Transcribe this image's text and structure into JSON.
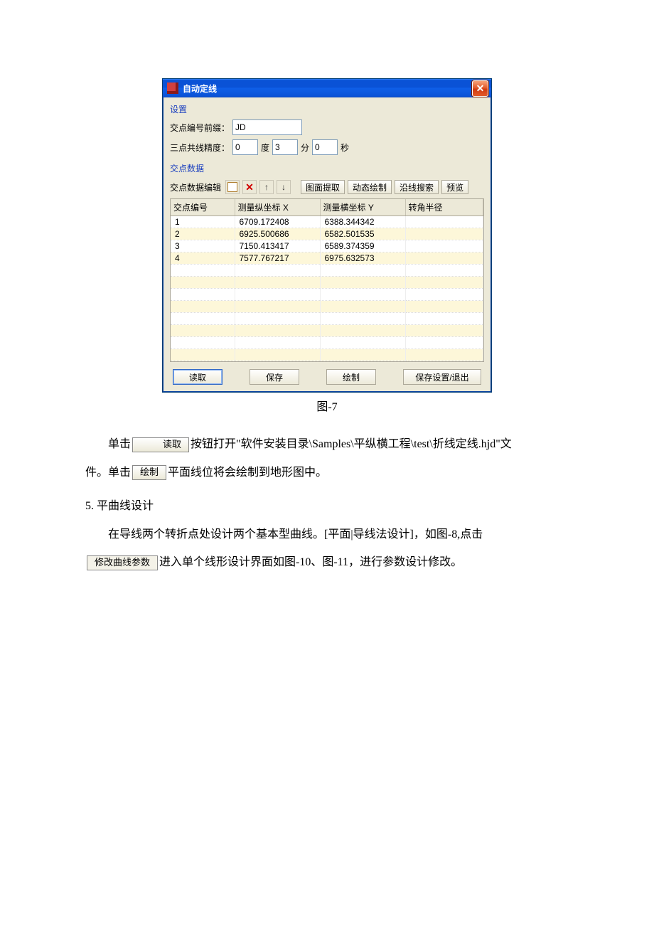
{
  "dialog": {
    "title": "自动定线",
    "group_settings": "设置",
    "prefix_label": "交点编号前缀：",
    "prefix_value": "JD",
    "precision_label": "三点共线精度：",
    "deg_value": "0",
    "deg_unit": "度",
    "min_value": "3",
    "min_unit": "分",
    "sec_value": "0",
    "sec_unit": "秒",
    "group_data": "交点数据",
    "edit_label": "交点数据编辑",
    "btn_extract": "图面提取",
    "btn_dynamic": "动态绘制",
    "btn_search": "沿线搜索",
    "btn_preview": "预览",
    "headers": [
      "交点编号",
      "测量纵坐标 X",
      "测量横坐标 Y",
      "转角半径"
    ],
    "rows": [
      {
        "id": "1",
        "x": "6709.172408",
        "y": "6388.344342",
        "r": ""
      },
      {
        "id": "2",
        "x": "6925.500686",
        "y": "6582.501535",
        "r": ""
      },
      {
        "id": "3",
        "x": "7150.413417",
        "y": "6589.374359",
        "r": ""
      },
      {
        "id": "4",
        "x": "7577.767217",
        "y": "6975.632573",
        "r": ""
      }
    ],
    "btn_read": "读取",
    "btn_save": "保存",
    "btn_draw": "绘制",
    "btn_save_exit": "保存设置/退出"
  },
  "caption": "图-7",
  "body": {
    "p1_prefix": "单击",
    "btn_read": "读取",
    "p1_suffix": "按钮打开\"软件安装目录\\Samples\\平纵横工程\\test\\折线定线.hjd\"文",
    "p2_prefix": "件。单击",
    "btn_draw": "绘制",
    "p2_suffix": "平面线位将会绘制到地形图中。",
    "section5": "5. 平曲线设计",
    "p3": "在导线两个转折点处设计两个基本型曲线。[平面|导线法设计]，如图-8,点击",
    "btn_modify": "修改曲线参数",
    "p4_suffix": "进入单个线形设计界面如图-10、图-11，进行参数设计修改。"
  }
}
